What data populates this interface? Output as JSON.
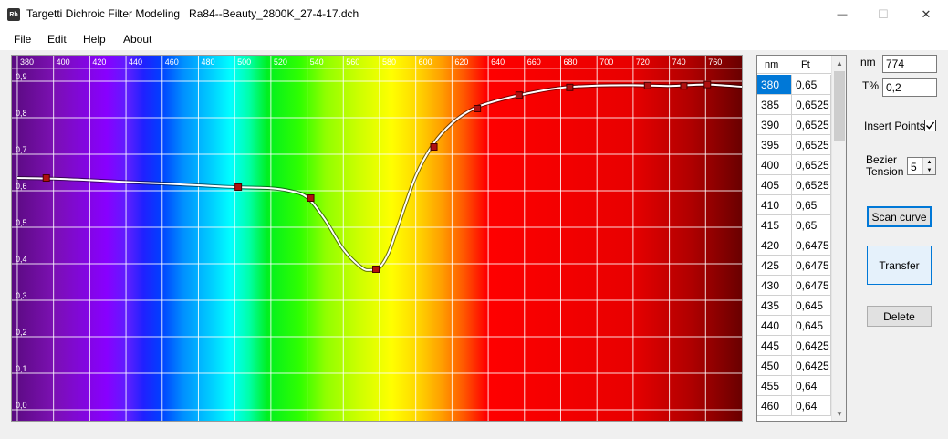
{
  "window": {
    "icon_text": "Rb",
    "title": "Targetti Dichroic Filter Modeling   Ra84--Beauty_2800K_27-4-17.dch",
    "minimize_glyph": "—",
    "maximize_glyph": "☐",
    "close_glyph": "✕"
  },
  "menu": {
    "items": [
      "File",
      "Edit",
      "Help",
      "About"
    ]
  },
  "chart_data": {
    "type": "line",
    "x_ticks": [
      "380",
      "400",
      "420",
      "440",
      "460",
      "480",
      "500",
      "520",
      "540",
      "560",
      "580",
      "600",
      "620",
      "640",
      "660",
      "680",
      "700",
      "720",
      "740",
      "760"
    ],
    "y_ticks": [
      "0,9",
      "0,8",
      "0,7",
      "0,6",
      "0,5",
      "0,4",
      "0,3",
      "0,2",
      "0,1",
      "0,0"
    ],
    "xlim": [
      377,
      780
    ],
    "ylim": [
      0.0,
      0.9
    ],
    "control_points": {
      "x": [
        396,
        502,
        542,
        578,
        610,
        634,
        657,
        685,
        728,
        748,
        761
      ],
      "y": [
        0.635,
        0.61,
        0.58,
        0.385,
        0.72,
        0.825,
        0.862,
        0.883,
        0.888,
        0.887,
        0.891
      ]
    },
    "curve": {
      "x": [
        380,
        400,
        420,
        440,
        460,
        480,
        500,
        520,
        530,
        540,
        550,
        560,
        570,
        575,
        580,
        585,
        590,
        600,
        610,
        620,
        630,
        640,
        660,
        680,
        700,
        720,
        740,
        760,
        780
      ],
      "y": [
        0.635,
        0.633,
        0.629,
        0.624,
        0.62,
        0.615,
        0.61,
        0.607,
        0.6,
        0.582,
        0.52,
        0.44,
        0.39,
        0.383,
        0.39,
        0.43,
        0.5,
        0.64,
        0.73,
        0.785,
        0.82,
        0.84,
        0.865,
        0.882,
        0.888,
        0.889,
        0.887,
        0.891,
        0.885
      ]
    }
  },
  "table": {
    "headers": [
      "nm",
      "Ft"
    ],
    "rows": [
      [
        "380",
        "0,65"
      ],
      [
        "385",
        "0,6525"
      ],
      [
        "390",
        "0,6525"
      ],
      [
        "395",
        "0,6525"
      ],
      [
        "400",
        "0,6525"
      ],
      [
        "405",
        "0,6525"
      ],
      [
        "410",
        "0,65"
      ],
      [
        "415",
        "0,65"
      ],
      [
        "420",
        "0,6475"
      ],
      [
        "425",
        "0,6475"
      ],
      [
        "430",
        "0,6475"
      ],
      [
        "435",
        "0,645"
      ],
      [
        "440",
        "0,645"
      ],
      [
        "445",
        "0,6425"
      ],
      [
        "450",
        "0,6425"
      ],
      [
        "455",
        "0,64"
      ],
      [
        "460",
        "0,64"
      ]
    ],
    "scroll_up": "▲",
    "scroll_down": "▼"
  },
  "controls": {
    "nm_label": "nm",
    "nm_value": "774",
    "t_label": "T%",
    "t_value": "0,2",
    "insert_points_label": "Insert Points",
    "insert_points_checked": true,
    "bezier_label_1": "Bezier",
    "bezier_label_2": "Tension",
    "bezier_value": "5",
    "scan_curve_label": "Scan curve",
    "transfer_label": "Transfer",
    "delete_label": "Delete"
  },
  "colors": {
    "control_point": "#b01010",
    "curve": "#ffffff",
    "grid": "#ffffff",
    "selection": "#0078d7"
  }
}
